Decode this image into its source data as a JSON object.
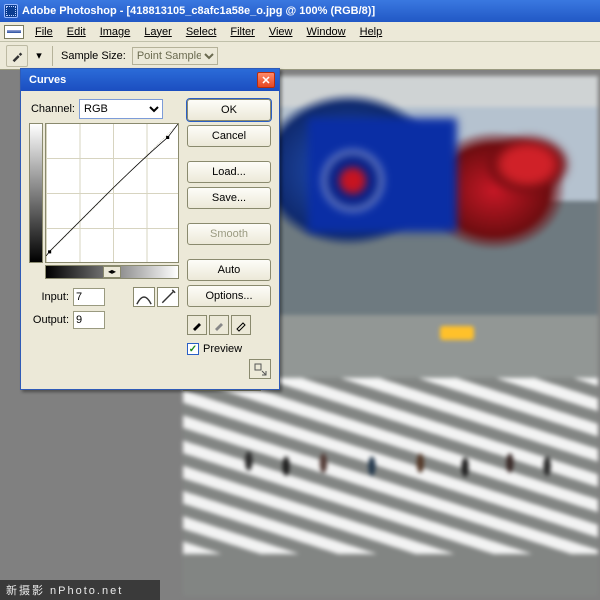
{
  "titlebar": {
    "app": "Adobe Photoshop",
    "doc": "[418813105_c8afc1a58e_o.jpg @ 100% (RGB/8)]"
  },
  "menus": [
    "File",
    "Edit",
    "Image",
    "Layer",
    "Select",
    "Filter",
    "View",
    "Window",
    "Help"
  ],
  "optbar": {
    "label": "Sample Size:",
    "value": "Point Sample"
  },
  "curves": {
    "title": "Curves",
    "channel_label": "Channel:",
    "channel_value": "RGB",
    "input_label": "Input:",
    "input_value": "7",
    "output_label": "Output:",
    "output_value": "9",
    "grad_mid": "◂▸",
    "buttons": {
      "ok": "OK",
      "cancel": "Cancel",
      "load": "Load...",
      "save": "Save...",
      "smooth": "Smooth",
      "auto": "Auto",
      "options": "Options..."
    },
    "preview_label": "Preview",
    "preview_checked": true
  },
  "chart_data": {
    "type": "line",
    "title": "Curves",
    "xlabel": "Input",
    "ylabel": "Output",
    "xlim": [
      0,
      255
    ],
    "ylim": [
      0,
      255
    ],
    "grid": true,
    "series": [
      {
        "name": "RGB",
        "x": [
          0,
          7,
          32,
          64,
          96,
          128,
          160,
          192,
          224,
          235,
          255
        ],
        "values": [
          0,
          9,
          36,
          68,
          99,
          130,
          160,
          190,
          219,
          229,
          255
        ]
      }
    ],
    "diagonal_reference": {
      "x": [
        0,
        255
      ],
      "values": [
        0,
        255
      ]
    }
  },
  "watermark": "新摄影 nPhoto.net",
  "adj_panel": {
    "fg_color": "#f6ad3f",
    "bg_color": "#878787",
    "rows": [
      [
        "standard-mask-icon",
        "quick-mask-icon"
      ],
      [
        "standard-screen-icon",
        "full-screen-menu-icon",
        "full-screen-icon"
      ],
      [
        "jump-imageready-icon",
        "jump-arrow-icon"
      ]
    ]
  }
}
